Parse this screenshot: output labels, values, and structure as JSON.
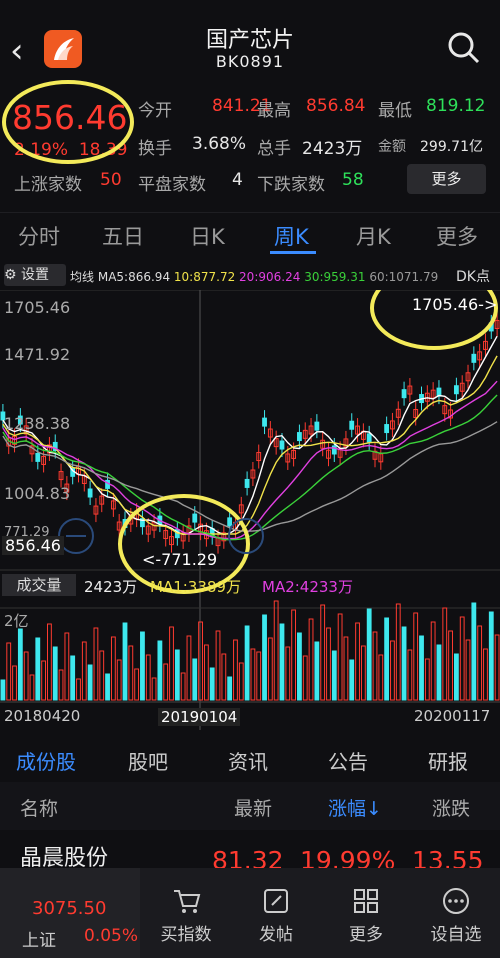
{
  "header": {
    "title": "国产芯片",
    "code": "BK0891"
  },
  "quote": {
    "price": "856.46",
    "change_pct": "2.19%",
    "change_abs": "18.39",
    "open_label": "今开",
    "open": "841.21",
    "high_label": "最高",
    "high": "856.84",
    "low_label": "最低",
    "low": "819.12",
    "turnover_label": "换手",
    "turnover": "3.68%",
    "volume_label": "总手",
    "volume": "2423万",
    "amount_label": "金额",
    "amount": "299.71亿",
    "up_label": "上涨家数",
    "up": "50",
    "flat_label": "平盘家数",
    "flat": "4",
    "down_label": "下跌家数",
    "down": "58",
    "more": "更多"
  },
  "tabs": [
    "分时",
    "五日",
    "日K",
    "周K",
    "月K",
    "更多"
  ],
  "active_tab": "周K",
  "ma": {
    "settings": "设置",
    "label": "均线",
    "ma5": "MA5:866.94",
    "ma10": "10:877.72",
    "ma20": "20:906.24",
    "ma30": "30:959.31",
    "ma60": "60:1071.79",
    "dk": "DK点"
  },
  "chart": {
    "y_labels": [
      "1705.46",
      "1471.92",
      "1238.38",
      "1004.83",
      "771.29"
    ],
    "last_price_label": "856.46",
    "high_marker": "1705.46->",
    "low_marker": "<-771.29",
    "volume_label": "成交量",
    "volume_value": "2423万",
    "vma1": "MA1:3389万",
    "vma2": "MA2:4233万",
    "vol_ylabel": "2亿",
    "dates": [
      "20180420",
      "20190104",
      "20200117"
    ]
  },
  "list_tabs": [
    "成份股",
    "股吧",
    "资讯",
    "公告",
    "研报"
  ],
  "list_head": {
    "name": "名称",
    "latest": "最新",
    "pct": "涨幅↓",
    "chg": "涨跌"
  },
  "rows": [
    {
      "name": "晶晨股份",
      "latest": "81.32",
      "pct": "19.99%",
      "chg": "13.55"
    }
  ],
  "bottom": {
    "index_value": "3075.50",
    "index_name": "上证",
    "index_pct": "0.05%",
    "items": [
      "买指数",
      "发帖",
      "更多",
      "设自选"
    ]
  }
}
